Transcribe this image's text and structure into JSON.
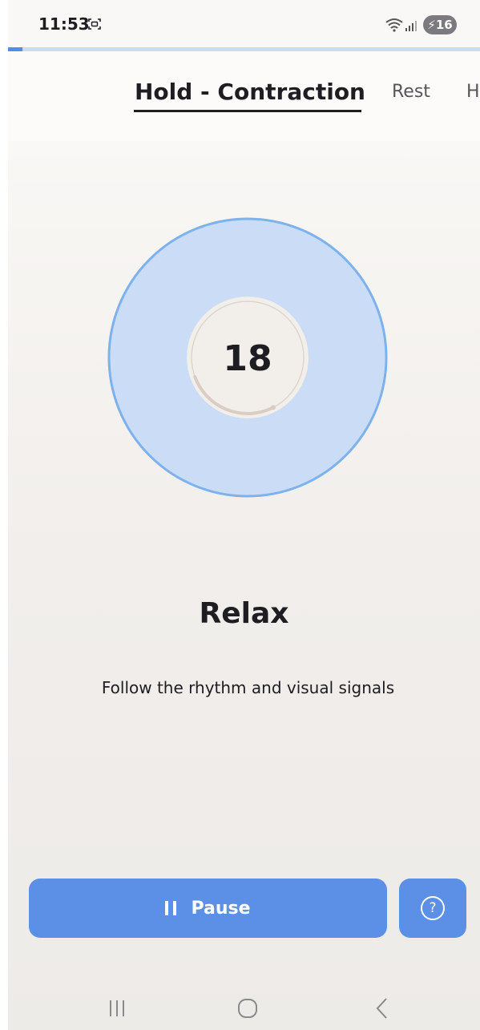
{
  "status_bar": {
    "time": "11:53",
    "battery": "16",
    "icons": [
      "screenshot-icon",
      "wifi-icon",
      "signal-icon",
      "battery-charging-icon"
    ]
  },
  "progress": {
    "fraction": 0.03
  },
  "tabs": {
    "items": [
      {
        "label": "Hold - Contraction",
        "active": true
      },
      {
        "label": "Rest",
        "active": false
      },
      {
        "label": "H",
        "active": false
      }
    ]
  },
  "timer": {
    "value": "18",
    "arc_fraction": 0.27
  },
  "phase": {
    "label": "Relax"
  },
  "instruction": {
    "text": "Follow the rhythm and visual signals"
  },
  "controls": {
    "pause_label": "Pause",
    "pause_icon": "pause-icon",
    "help_icon": "help-icon",
    "help_glyph": "?"
  },
  "nav": {
    "icons": [
      "recents-icon",
      "home-icon",
      "back-icon"
    ]
  },
  "colors": {
    "accent": "#5b90e6",
    "circle_fill": "#cadcf6",
    "circle_stroke": "#7db2ec",
    "arc": "#d9cdc4"
  }
}
